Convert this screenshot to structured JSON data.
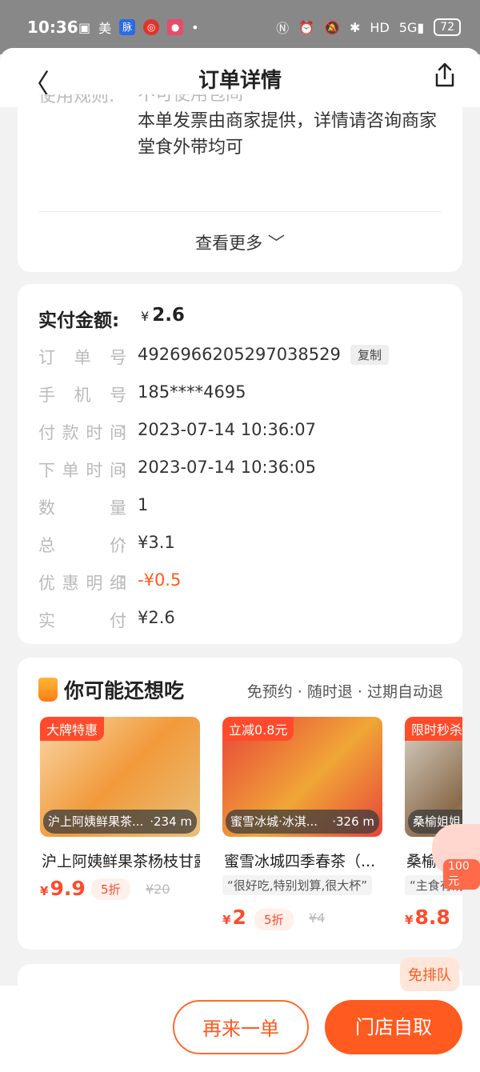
{
  "status_bar": {
    "time": "10:36",
    "left_icons": [
      "bilibili-icon",
      "meituan-icon",
      "maimai-icon",
      "netease-music-icon",
      "app-icon",
      "dot-icon"
    ],
    "right_icons": [
      "nfc-icon",
      "alarm-icon",
      "mute-icon",
      "bluetooth-icon",
      "hd-icon",
      "5g-signal-icon"
    ],
    "battery": "72"
  },
  "header": {
    "title": "订单详情"
  },
  "rules_card": {
    "label": "使用规则:",
    "lines": [
      "不可使用包间",
      "本单发票由商家提供，详情请咨询商家",
      "堂食外带均可"
    ],
    "more": "查看更多 ﹀"
  },
  "order_card": {
    "paid_label": "实付金额:",
    "paid_currency": "¥",
    "paid_value": "2.6",
    "copy_label": "复制",
    "rows": [
      {
        "key": "订单号",
        "value": "4926966205297038529"
      },
      {
        "key": "手机号",
        "value": "185****4695"
      },
      {
        "key": "付款时间",
        "value": "2023-07-14 10:36:07"
      },
      {
        "key": "下单时间",
        "value": "2023-07-14 10:36:05"
      },
      {
        "key": "数量",
        "value": "1"
      },
      {
        "key": "总价",
        "value": "¥3.1"
      },
      {
        "key": "优惠明细",
        "value": "-¥0.5"
      },
      {
        "key": "实付",
        "value": "¥2.6"
      }
    ],
    "colon": ":"
  },
  "recommend": {
    "title": "你可能还想吃",
    "tags": "免预约 · 随时退 · 过期自动退",
    "items": [
      {
        "badge": "大牌特惠",
        "store": "沪上阿姨鲜果茶...",
        "distance": "·234 m",
        "name": "沪上阿姨鲜果茶杨枝甘露",
        "quote": "",
        "currency": "¥",
        "price": "9.9",
        "discount": "5折",
        "original": "¥20"
      },
      {
        "badge": "立减0.8元",
        "store": "蜜雪冰城·冰淇...",
        "distance": "·326 m",
        "name": "蜜雪冰城四季春茶（...",
        "quote": "“很好吃,特别划算,很大杯”",
        "currency": "¥",
        "price": "2",
        "discount": "5折",
        "original": "¥4"
      },
      {
        "badge": "限时秒杀",
        "store": "桑榆姐姐",
        "distance": "",
        "name": "桑榆姐姐",
        "quote": "“主食有汤",
        "currency": "¥",
        "price": "8.8",
        "discount": "",
        "original": ""
      }
    ]
  },
  "bottom": {
    "again": "再来一单",
    "pickup": "门店自取",
    "queue": "免排队",
    "float_tag": "100元"
  },
  "colors": {
    "accent": "#ff5a1f",
    "badge": "#ff4b2b"
  }
}
